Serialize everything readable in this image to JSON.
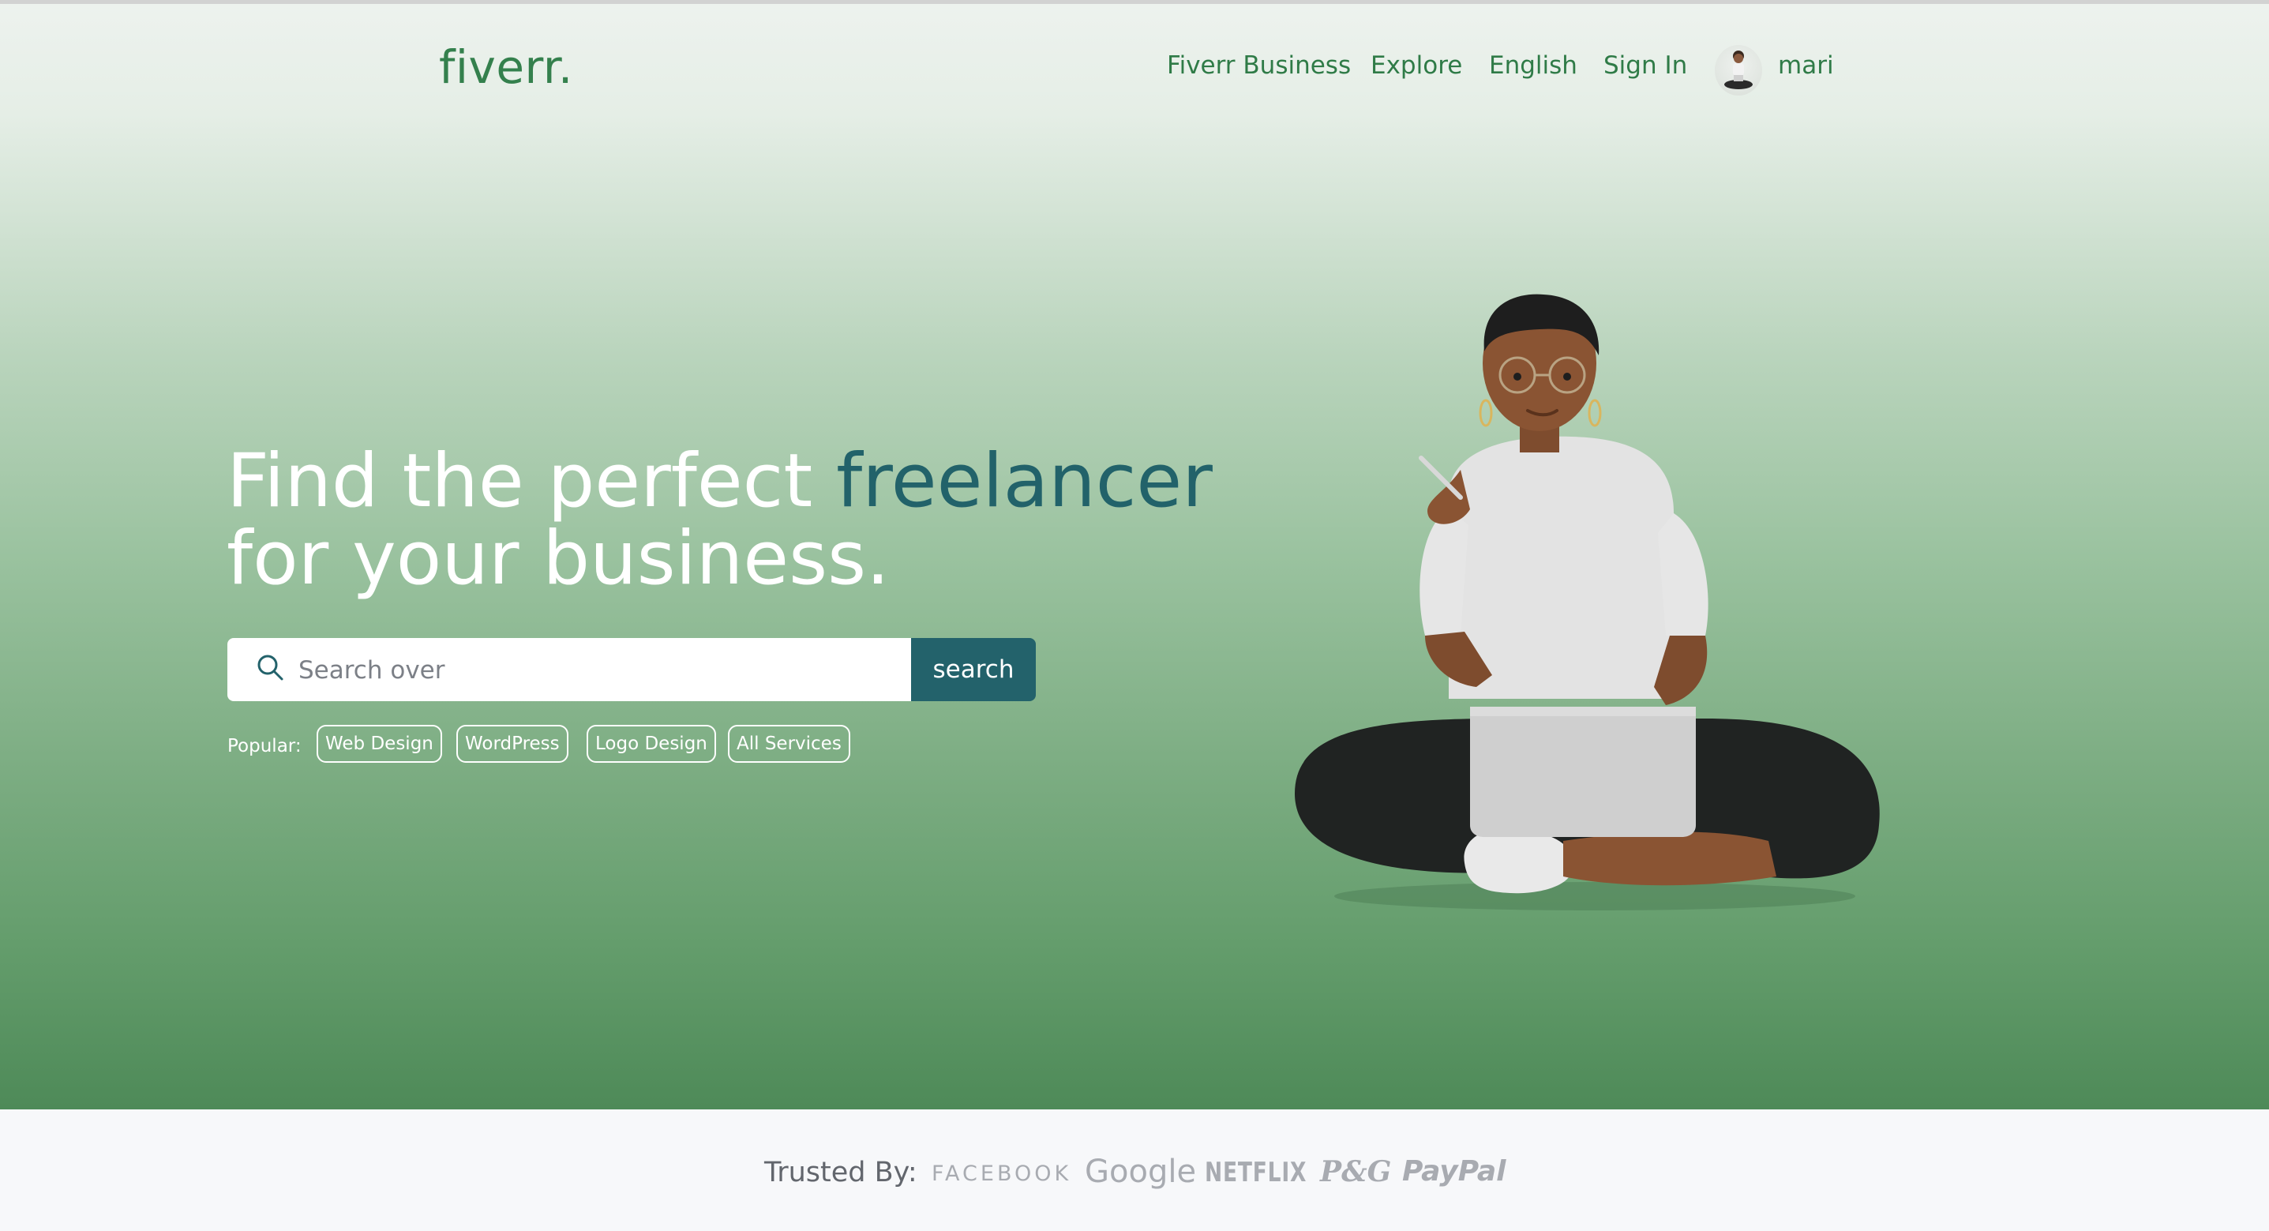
{
  "header": {
    "logo": "fiverr.",
    "nav": [
      {
        "label": "Fiverr Business"
      },
      {
        "label": "Explore"
      },
      {
        "label": "English"
      },
      {
        "label": "Sign In"
      }
    ],
    "user": {
      "name": "mari"
    }
  },
  "hero": {
    "headline_part1": "Find the perfect ",
    "headline_accent": "freelancer",
    "headline_line2": "for your business.",
    "search": {
      "placeholder": "Search over",
      "value": "",
      "button_label": "search"
    },
    "popular": {
      "label": "Popular:",
      "tags": [
        "Web Design",
        "WordPress",
        "Logo Design",
        "All Services"
      ]
    }
  },
  "trusted": {
    "label": "Trusted By:",
    "brands": [
      "FACEBOOK",
      "Google",
      "NETFLIX",
      "P&G",
      "PayPal"
    ]
  },
  "colors": {
    "brand_green": "#34804d",
    "accent_teal": "#23626b",
    "hero_top": "#edf2ee",
    "hero_bottom": "#4e8a58"
  },
  "icons": {
    "search": "search-icon",
    "avatar": "user-avatar"
  }
}
